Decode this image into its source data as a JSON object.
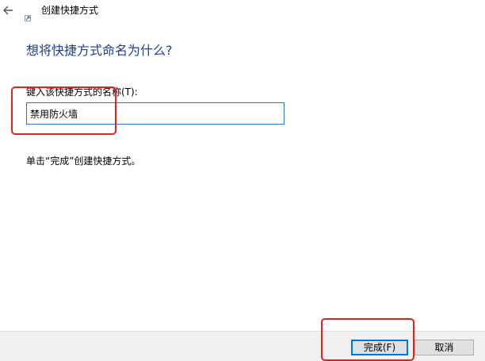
{
  "header": {
    "back_icon": "arrow-left-icon",
    "shortcut_icon": "shortcut-icon",
    "title": "创建快捷方式"
  },
  "main": {
    "heading": "想将快捷方式命名为什么?",
    "field_label": "键入该快捷方式的名称(T):",
    "field_value": "禁用防火墙",
    "hint": "单击“完成”创建快捷方式。"
  },
  "footer": {
    "finish_label": "完成(F)",
    "cancel_label": "取消"
  },
  "colors": {
    "heading": "#1f3f8f",
    "highlight": "#e0231b",
    "input_border": "#2b78c5",
    "primary_button_border": "#0078d7"
  }
}
